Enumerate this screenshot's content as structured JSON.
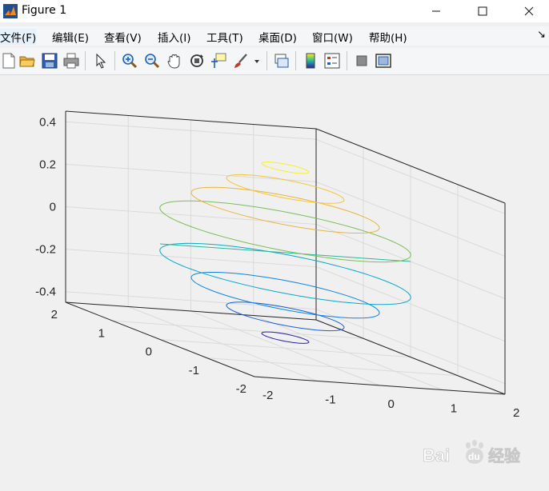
{
  "window": {
    "title": "Figure 1",
    "minimize_glyph": "—",
    "maximize_glyph": "☐",
    "close_glyph": "✕"
  },
  "menubar": {
    "items": [
      {
        "label": "文件(F)"
      },
      {
        "label": "编辑(E)"
      },
      {
        "label": "查看(V)"
      },
      {
        "label": "插入(I)"
      },
      {
        "label": "工具(T)"
      },
      {
        "label": "桌面(D)"
      },
      {
        "label": "窗口(W)"
      },
      {
        "label": "帮助(H)"
      }
    ],
    "corner_glyph": "↘"
  },
  "toolbar": {
    "buttons": [
      {
        "icon": "new-file-icon"
      },
      {
        "icon": "open-folder-icon"
      },
      {
        "icon": "save-icon"
      },
      {
        "icon": "print-icon"
      },
      {
        "icon": "pointer-icon"
      },
      {
        "icon": "zoom-in-icon"
      },
      {
        "icon": "zoom-out-icon"
      },
      {
        "icon": "pan-hand-icon"
      },
      {
        "icon": "rotate-3d-icon"
      },
      {
        "icon": "data-cursor-icon"
      },
      {
        "icon": "brush-icon"
      },
      {
        "icon": "link-plot-icon"
      },
      {
        "icon": "colorbar-icon"
      },
      {
        "icon": "legend-icon"
      },
      {
        "icon": "hide-plot-tools-icon"
      },
      {
        "icon": "show-plot-tools-icon"
      }
    ]
  },
  "chart_data": {
    "type": "line",
    "dimensions": 3,
    "colormap": "parula",
    "grid": true,
    "box": "on",
    "z_ticks": [
      "0.4",
      "0.2",
      "0",
      "-0.2",
      "-0.4"
    ],
    "y_ticks": [
      "2",
      "1",
      "0",
      "-1",
      "-2"
    ],
    "x_ticks": [
      "-2",
      "-1",
      "0",
      "1",
      "2"
    ],
    "xlim": [
      -2,
      2
    ],
    "ylim": [
      -2,
      2
    ],
    "zlim": [
      -0.45,
      0.45
    ],
    "series": [
      {
        "color": "#2a1ea8",
        "z": -0.4,
        "radius": 0.3
      },
      {
        "color": "#1560d9",
        "z": -0.3,
        "radius": 0.75
      },
      {
        "color": "#0b85e0",
        "z": -0.2,
        "radius": 1.2
      },
      {
        "color": "#0aa8c8",
        "z": -0.1,
        "radius": 1.6
      },
      {
        "color": "#2ab79a",
        "z": 0.0,
        "radius": 0.0
      },
      {
        "color": "#7cbd5a",
        "z": 0.1,
        "radius": 1.6
      },
      {
        "color": "#e8b540",
        "z": 0.2,
        "radius": 1.2
      },
      {
        "color": "#f3c53a",
        "z": 0.3,
        "radius": 0.75
      },
      {
        "color": "#f8f020",
        "z": 0.4,
        "radius": 0.3
      }
    ]
  },
  "watermark": {
    "text": "Bai",
    "text2": "经验",
    "paw": "du"
  }
}
